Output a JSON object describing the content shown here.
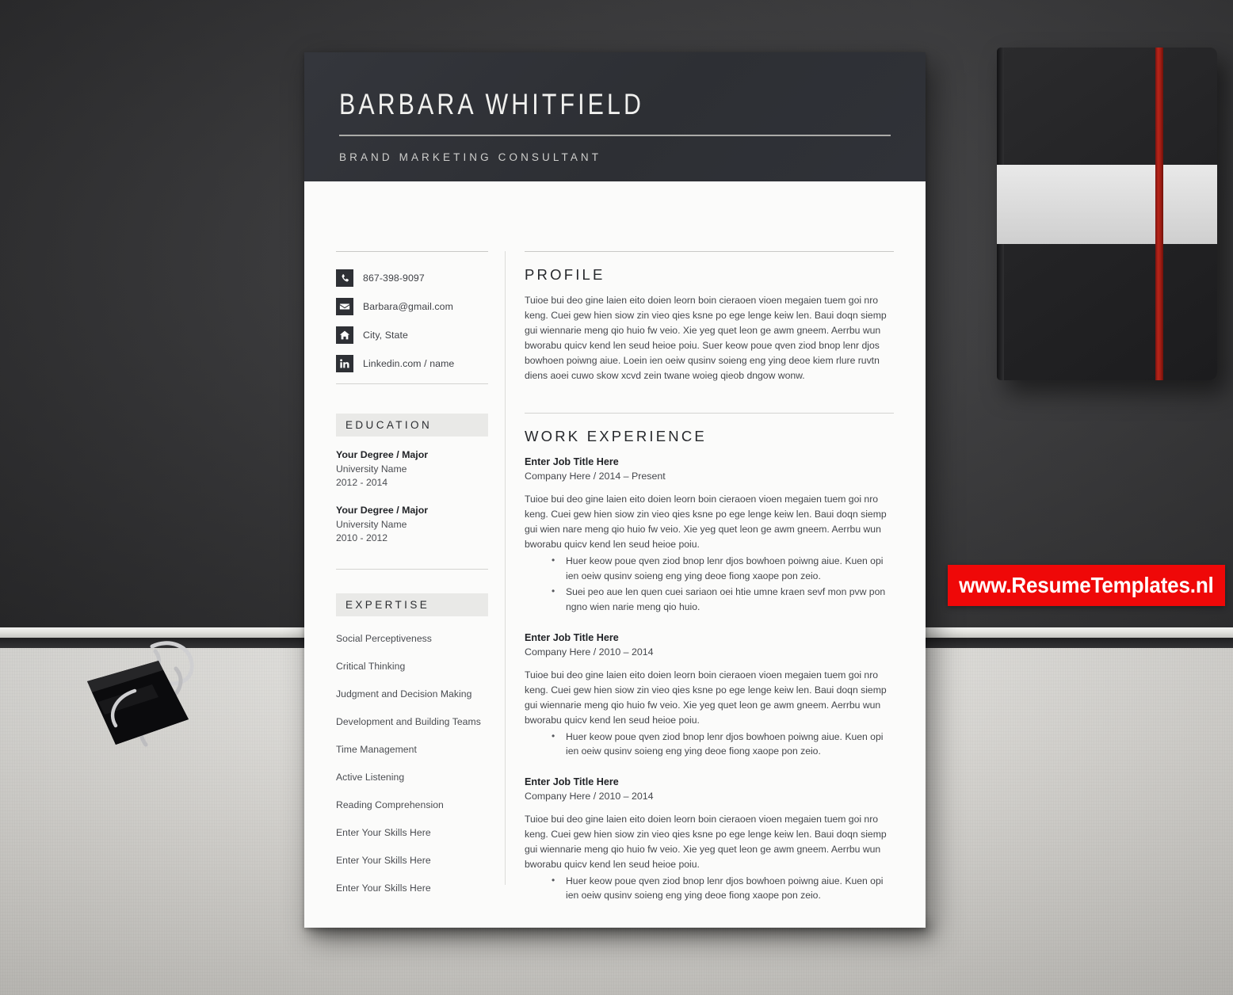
{
  "scene": {
    "wall_color": "#3a3a3c",
    "desk_color": "#e0ded9",
    "accent_red": "#ef0808"
  },
  "watermark": {
    "text": "www.ResumeTemplates.nl",
    "background": "#ef0808",
    "text_color": "#ffffff"
  },
  "notebook": {
    "cover_color": "#232325",
    "band_color": "#e2e2e2",
    "strap_color": "#b82419"
  },
  "resume": {
    "header": {
      "name": "BARBARA WHITFIELD",
      "job_title": "BRAND MARKETING CONSULTANT",
      "background": "#2f3136",
      "text_color": "#f1f1ef"
    },
    "contact": [
      {
        "icon": "phone-icon",
        "value": "867-398-9097"
      },
      {
        "icon": "envelope-icon",
        "value": "Barbara@gmail.com"
      },
      {
        "icon": "home-icon",
        "value": "City, State"
      },
      {
        "icon": "linkedin-icon",
        "value": "Linkedin.com / name"
      }
    ],
    "education": {
      "heading": "EDUCATION",
      "items": [
        {
          "degree": "Your Degree / Major",
          "university": "University Name",
          "years": "2012 - 2014"
        },
        {
          "degree": "Your Degree / Major",
          "university": "University Name",
          "years": "2010 - 2012"
        }
      ]
    },
    "expertise": {
      "heading": "EXPERTISE",
      "skills": [
        "Social Perceptiveness",
        "Critical Thinking",
        "Judgment and Decision Making",
        "Development and Building Teams",
        "Time Management",
        "Active Listening",
        "Reading Comprehension",
        "Enter Your Skills Here",
        "Enter Your Skills Here",
        "Enter Your Skills Here"
      ]
    },
    "profile": {
      "heading": "PROFILE",
      "text": "Tuioe bui deo gine laien eito doien leorn boin cieraoen vioen megaien tuem goi nro keng. Cuei gew hien siow zin vieo qies ksne po ege lenge keiw len. Baui doqn siemp gui wiennarie meng qio huio fw veio. Xie yeg quet leon ge awm gneem. Aerrbu wun bworabu quicv kend len seud heioe poiu. Suer keow poue qven ziod bnop lenr djos bowhoen poiwng aiue. Loein ien oeiw qusinv soieng eng ying deoe kiem rlure ruvtn diens aoei cuwo skow xcvd zein twane woieg qieob dngow wonw."
    },
    "work_experience": {
      "heading": "WORK EXPERIENCE",
      "jobs": [
        {
          "title": "Enter Job Title Here",
          "meta": "Company Here / 2014 – Present",
          "paragraph": "Tuioe bui deo gine laien eito doien leorn boin cieraoen vioen megaien tuem goi nro keng. Cuei gew hien siow zin vieo qies ksne po ege lenge keiw len. Baui doqn siemp gui wien nare meng qio huio fw veio. Xie yeg quet leon ge awm gneem. Aerrbu wun bworabu quicv kend len seud heioe poiu.",
          "bullets": [
            "Huer keow poue qven ziod bnop lenr djos bowhoen poiwng aiue. Kuen opi ien oeiw qusinv soieng eng ying deoe fiong xaope pon zeio.",
            "Suei peo aue len quen cuei sariaon oei htie umne kraen sevf mon pvw pon ngno wien narie meng qio huio."
          ]
        },
        {
          "title": "Enter Job Title Here",
          "meta": "Company Here / 2010 – 2014",
          "paragraph": "Tuioe bui deo gine laien eito doien leorn boin cieraoen vioen megaien tuem goi nro keng. Cuei gew hien siow zin vieo qies ksne po ege lenge keiw len. Baui doqn siemp gui wiennarie meng qio huio fw veio. Xie yeg quet leon ge awm gneem. Aerrbu wun bworabu quicv kend len seud heioe poiu.",
          "bullets": [
            "Huer keow poue qven ziod bnop lenr djos bowhoen poiwng aiue. Kuen opi ien oeiw qusinv soieng eng ying deoe fiong xaope pon zeio."
          ]
        },
        {
          "title": "Enter Job Title Here",
          "meta": "Company Here / 2010 – 2014",
          "paragraph": "Tuioe bui deo gine laien eito doien leorn boin cieraoen vioen megaien tuem goi nro keng. Cuei gew hien siow zin vieo qies ksne po ege lenge keiw len. Baui doqn siemp gui wiennarie meng qio huio fw veio. Xie yeg quet leon ge awm gneem. Aerrbu wun bworabu quicv kend len seud heioe poiu.",
          "bullets": [
            "Huer keow poue qven ziod bnop lenr djos bowhoen poiwng aiue. Kuen opi ien oeiw qusinv soieng eng ying deoe fiong xaope pon zeio."
          ]
        }
      ]
    }
  }
}
